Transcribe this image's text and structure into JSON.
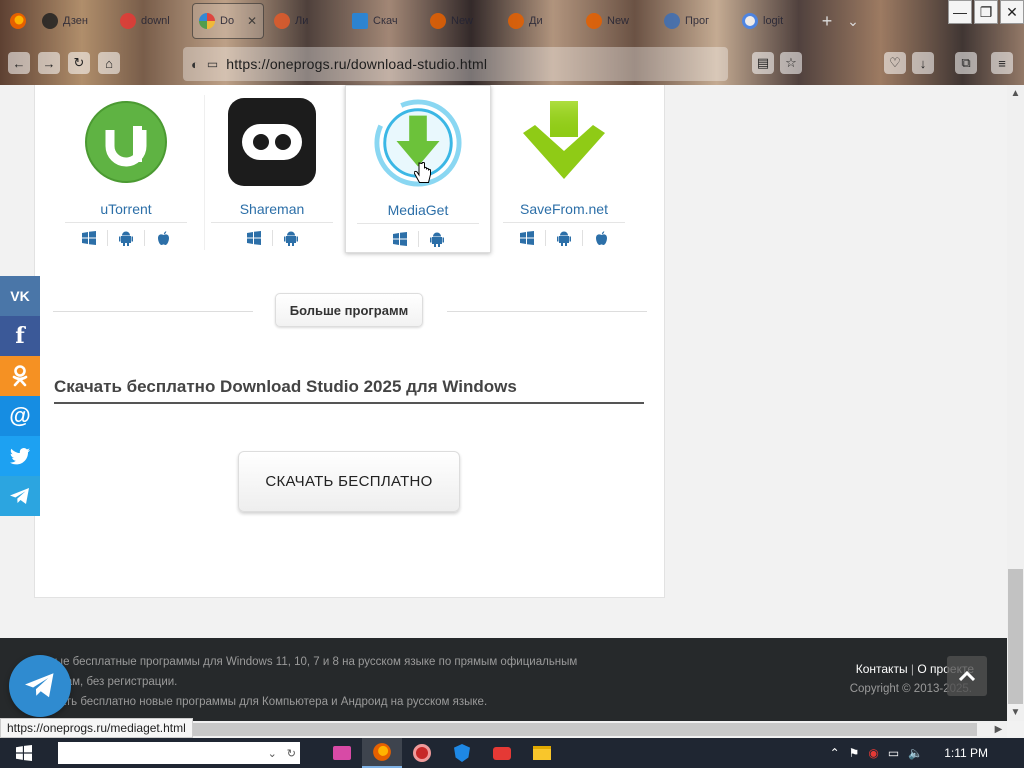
{
  "browser": {
    "tabs": [
      {
        "label": "Дзен",
        "color": "#222222"
      },
      {
        "label": "downl",
        "color": "#e53935"
      },
      {
        "label": "Do",
        "color": "#43a047",
        "active": true
      },
      {
        "label": "Ли",
        "color": "#e35b2a"
      },
      {
        "label": "Скач",
        "color": "#1e88e5"
      },
      {
        "label": "New",
        "color": "#e66000"
      },
      {
        "label": "Ди",
        "color": "#e66000"
      },
      {
        "label": "New",
        "color": "#e66000"
      },
      {
        "label": "Прог",
        "color": "#3d6fb6"
      },
      {
        "label": "logit",
        "color": "#4285f4"
      }
    ],
    "new_tab": "+",
    "tab_list": "⌄",
    "url": "https://oneprogs.ru/download-studio.html",
    "url_display": "oneprogs.ru/download-studio.html",
    "window_controls": {
      "minimize": "—",
      "maximize": "❐",
      "close": "✕"
    }
  },
  "apps": [
    {
      "name": "uTorrent",
      "platforms": [
        "windows",
        "android",
        "apple"
      ],
      "accent": "#62b245"
    },
    {
      "name": "Shareman",
      "platforms": [
        "windows",
        "android"
      ],
      "accent": "#1c1c1c"
    },
    {
      "name": "MediaGet",
      "platforms": [
        "windows",
        "android"
      ],
      "accent": "#3bb7e5"
    },
    {
      "name": "SaveFrom.net",
      "platforms": [
        "windows",
        "android",
        "apple"
      ],
      "accent": "#8fcb16"
    }
  ],
  "more_button": "Больше программ",
  "download_title": "Скачать бесплатно Download Studio 2025 для Windows",
  "download_button": "СКАЧАТЬ БЕСПЛАТНО",
  "social": [
    {
      "icon": "vk-icon",
      "glyph": "VK",
      "color": "#4a76a8"
    },
    {
      "icon": "facebook-icon",
      "glyph": "f",
      "color": "#3b5998"
    },
    {
      "icon": "odnoklassniki-icon",
      "glyph": "ок",
      "color": "#f59123"
    },
    {
      "icon": "mail-at-icon",
      "glyph": "@",
      "color": "#168de2"
    },
    {
      "icon": "twitter-icon",
      "glyph": "t",
      "color": "#1da1f2"
    },
    {
      "icon": "telegram-icon",
      "glyph": "➤",
      "color": "#2ca5e0"
    }
  ],
  "footer": {
    "line1": "Новые бесплатные программы для Windows 11, 10, 7 и 8 на русском языке по прямым официальным",
    "line2": "ссылкам, без регистрации.",
    "line3": "Скачать бесплатно новые программы для Компьютера и Андроид на русском языке.",
    "contacts": "Контакты",
    "separator": "|",
    "about": "О проекте",
    "copyright": "Copyright © 2013-2025."
  },
  "status_url": "https://oneprogs.ru/mediaget.html",
  "taskbar": {
    "clock": "1:11 PM",
    "search_placeholder": ""
  }
}
